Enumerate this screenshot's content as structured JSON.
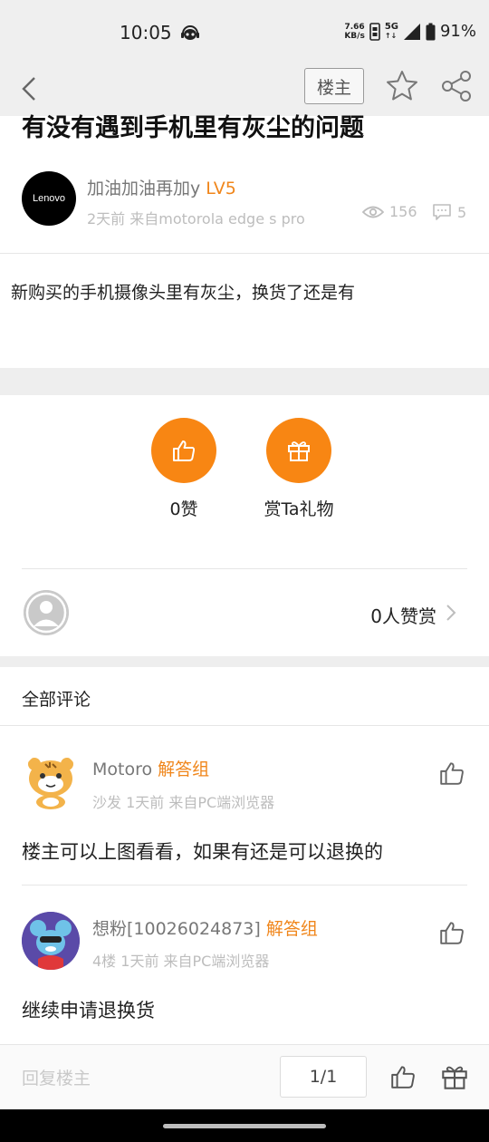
{
  "status_bar": {
    "time": "10:05",
    "speed_value": "7.66",
    "speed_unit": "KB/s",
    "network": "5G",
    "battery": "91%"
  },
  "nav": {
    "owner_button": "楼主"
  },
  "post": {
    "title": "有没有遇到手机里有灰尘的问题",
    "author": {
      "avatar_text": "Lenovo",
      "name": "加油加油再加y",
      "level": "LV5",
      "meta": "2天前   来自motorola edge s pro"
    },
    "views": "156",
    "comments": "5",
    "body": "新购买的手机摄像头里有灰尘，换货了还是有"
  },
  "actions": {
    "like_label": "0赞",
    "gift_label": "赏Ta礼物"
  },
  "reward": {
    "text": "0人赞赏"
  },
  "comments_section": {
    "title": "全部评论",
    "items": [
      {
        "name": "Motoro",
        "group": "解答组",
        "meta": "沙发   1天前   来自PC端浏览器",
        "text": "楼主可以上图看看，如果有还是可以退换的"
      },
      {
        "name": "想粉[10026024873]",
        "group": "解答组",
        "meta": "4楼   1天前   来自PC端浏览器",
        "text": "继续申请退换货"
      }
    ]
  },
  "bottom_bar": {
    "reply_placeholder": "回复楼主",
    "page_indicator": "1/1"
  },
  "colors": {
    "accent": "#f88613",
    "status_bar_bg": "#efefef",
    "muted_text": "#bdbdbd"
  }
}
